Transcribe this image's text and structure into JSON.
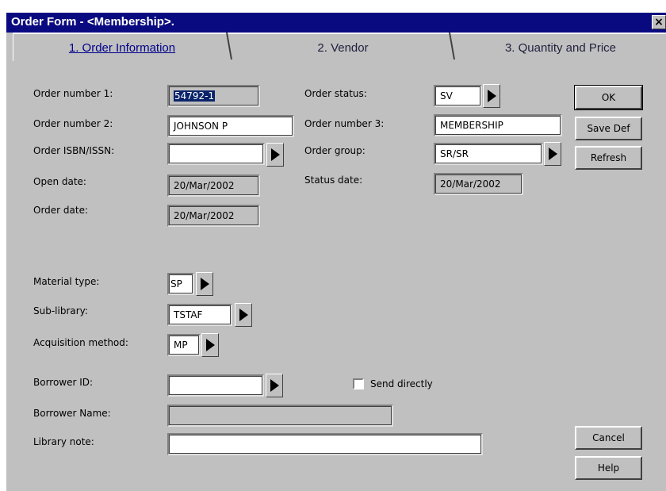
{
  "window": {
    "title": "Order Form - <Membership>.",
    "close_glyph": "×"
  },
  "tabs": [
    {
      "label": "1. Order Information"
    },
    {
      "label": "2. Vendor"
    },
    {
      "label": "3. Quantity and Price"
    }
  ],
  "form": {
    "order_number_1": {
      "label": "Order number 1:",
      "value": "54792-1"
    },
    "order_number_2": {
      "label": "Order number 2:",
      "value": "JOHNSON P"
    },
    "order_isbn": {
      "label": "Order ISBN/ISSN:",
      "value": ""
    },
    "open_date": {
      "label": "Open date:",
      "value": "20/Mar/2002"
    },
    "order_date": {
      "label": "Order date:",
      "value": "20/Mar/2002"
    },
    "order_status": {
      "label": "Order status:",
      "value": "SV"
    },
    "order_number_3": {
      "label": "Order number 3:",
      "value": "MEMBERSHIP"
    },
    "order_group": {
      "label": "Order group:",
      "value": "SR/SR"
    },
    "status_date": {
      "label": "Status date:",
      "value": "20/Mar/2002"
    },
    "material_type": {
      "label": "Material type:",
      "value": "SP"
    },
    "sub_library": {
      "label": "Sub-library:",
      "value": "TSTAF"
    },
    "acquisition_method": {
      "label": "Acquisition method:",
      "value": "MP"
    },
    "borrower_id": {
      "label": "Borrower ID:",
      "value": ""
    },
    "send_directly": {
      "label": "Send directly",
      "checked": false
    },
    "borrower_name": {
      "label": "Borrower Name:",
      "value": ""
    },
    "library_note": {
      "label": "Library note:",
      "value": ""
    }
  },
  "buttons": {
    "ok": "OK",
    "save_def": "Save Def",
    "refresh": "Refresh",
    "cancel": "Cancel",
    "help": "Help"
  },
  "colors": {
    "titlebar": "#0a0a80",
    "face": "#c0c0c0",
    "selection": "#0a246a",
    "tab_active_text": "#00008b"
  }
}
